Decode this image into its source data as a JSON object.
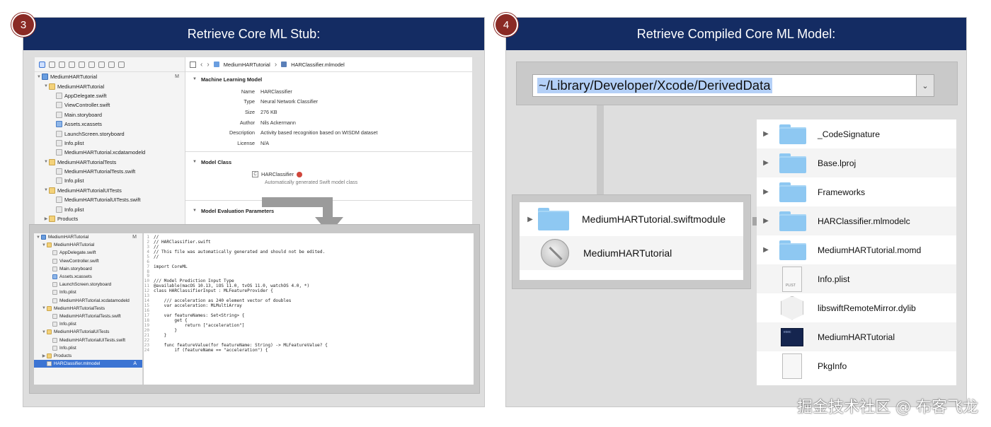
{
  "panel3": {
    "badge": "3",
    "title": "Retrieve Core ML Stub:",
    "navigator": [
      {
        "label": "MediumHARTutorial",
        "depth": 0,
        "icon": "project",
        "tri": "▼",
        "flag": "M"
      },
      {
        "label": "MediumHARTutorial",
        "depth": 1,
        "icon": "folder",
        "tri": "▼"
      },
      {
        "label": "AppDelegate.swift",
        "depth": 2,
        "icon": "file"
      },
      {
        "label": "ViewController.swift",
        "depth": 2,
        "icon": "file"
      },
      {
        "label": "Main.storyboard",
        "depth": 2,
        "icon": "file"
      },
      {
        "label": "Assets.xcassets",
        "depth": 2,
        "icon": "asset"
      },
      {
        "label": "LaunchScreen.storyboard",
        "depth": 2,
        "icon": "file"
      },
      {
        "label": "Info.plist",
        "depth": 2,
        "icon": "file"
      },
      {
        "label": "MediumHARTutorial.xcdatamodeld",
        "depth": 2,
        "icon": "file"
      },
      {
        "label": "MediumHARTutorialTests",
        "depth": 1,
        "icon": "folder",
        "tri": "▼"
      },
      {
        "label": "MediumHARTutorialTests.swift",
        "depth": 2,
        "icon": "file"
      },
      {
        "label": "Info.plist",
        "depth": 2,
        "icon": "file"
      },
      {
        "label": "MediumHARTutorialUITests",
        "depth": 1,
        "icon": "folder",
        "tri": "▼"
      },
      {
        "label": "MediumHARTutorialUITests.swift",
        "depth": 2,
        "icon": "file"
      },
      {
        "label": "Info.plist",
        "depth": 2,
        "icon": "file"
      },
      {
        "label": "Products",
        "depth": 1,
        "icon": "folder",
        "tri": "▶"
      }
    ],
    "breadcrumb": [
      "MediumHARTutorial",
      "HARClassifier.mlmodel"
    ],
    "ml_section_title": "Machine Learning Model",
    "ml_fields": [
      {
        "key": "Name",
        "value": "HARClassifier"
      },
      {
        "key": "Type",
        "value": "Neural Network Classifier"
      },
      {
        "key": "Size",
        "value": "276 KB"
      },
      {
        "key": "Author",
        "value": "Nils Ackermann"
      },
      {
        "key": "Description",
        "value": "Activity based recognition based on WISDM dataset"
      },
      {
        "key": "License",
        "value": "N/A"
      }
    ],
    "model_class_title": "Model Class",
    "model_class_name": "HARClassifier",
    "model_class_sub": "Automatically generated Swift model class",
    "eval_title": "Model Evaluation Parameters",
    "code_navigator": [
      {
        "label": "MediumHARTutorial",
        "depth": 0,
        "icon": "project",
        "tri": "▼",
        "flag": "M"
      },
      {
        "label": "MediumHARTutorial",
        "depth": 1,
        "icon": "folder",
        "tri": "▼"
      },
      {
        "label": "AppDelegate.swift",
        "depth": 2,
        "icon": "file"
      },
      {
        "label": "ViewController.swift",
        "depth": 2,
        "icon": "file"
      },
      {
        "label": "Main.storyboard",
        "depth": 2,
        "icon": "file"
      },
      {
        "label": "Assets.xcassets",
        "depth": 2,
        "icon": "asset"
      },
      {
        "label": "LaunchScreen.storyboard",
        "depth": 2,
        "icon": "file"
      },
      {
        "label": "Info.plist",
        "depth": 2,
        "icon": "file"
      },
      {
        "label": "MediumHARTutorial.xcdatamodeld",
        "depth": 2,
        "icon": "file"
      },
      {
        "label": "MediumHARTutorialTests",
        "depth": 1,
        "icon": "folder",
        "tri": "▼"
      },
      {
        "label": "MediumHARTutorialTests.swift",
        "depth": 2,
        "icon": "file"
      },
      {
        "label": "Info.plist",
        "depth": 2,
        "icon": "file"
      },
      {
        "label": "MediumHARTutorialUITests",
        "depth": 1,
        "icon": "folder",
        "tri": "▼"
      },
      {
        "label": "MediumHARTutorialUITests.swift",
        "depth": 2,
        "icon": "file"
      },
      {
        "label": "Info.plist",
        "depth": 2,
        "icon": "file"
      },
      {
        "label": "Products",
        "depth": 1,
        "icon": "folder",
        "tri": "▶"
      },
      {
        "label": "HARClassifier.mlmodel",
        "depth": 1,
        "icon": "file",
        "selected": true,
        "flag": "A"
      }
    ],
    "code_lines": [
      {
        "n": "1",
        "t": "//",
        "c": "cm"
      },
      {
        "n": "2",
        "t": "// HARClassifier.swift",
        "c": "cm"
      },
      {
        "n": "3",
        "t": "//",
        "c": "cm"
      },
      {
        "n": "4",
        "t": "// This file was automatically generated and should not be edited.",
        "c": "cm"
      },
      {
        "n": "5",
        "t": "//",
        "c": "cm"
      },
      {
        "n": "6",
        "t": "",
        "c": ""
      },
      {
        "n": "7",
        "t": "import CoreML",
        "c": "kw"
      },
      {
        "n": "8",
        "t": "",
        "c": ""
      },
      {
        "n": "9",
        "t": "",
        "c": ""
      },
      {
        "n": "10",
        "t": "/// Model Prediction Input Type",
        "c": "cm"
      },
      {
        "n": "11",
        "t": "@available(macOS 10.13, iOS 11.0, tvOS 11.0, watchOS 4.0, *)",
        "c": "kw"
      },
      {
        "n": "12",
        "t": "class HARClassifierInput : MLFeatureProvider {",
        "c": ""
      },
      {
        "n": "13",
        "t": "",
        "c": ""
      },
      {
        "n": "14",
        "t": "    /// acceleration as 240 element vector of doubles",
        "c": "cm"
      },
      {
        "n": "15",
        "t": "    var acceleration: MLMultiArray",
        "c": ""
      },
      {
        "n": "16",
        "t": "",
        "c": ""
      },
      {
        "n": "17",
        "t": "    var featureNames: Set<String> {",
        "c": ""
      },
      {
        "n": "18",
        "t": "        get {",
        "c": ""
      },
      {
        "n": "19",
        "t": "            return [\"acceleration\"]",
        "c": ""
      },
      {
        "n": "20",
        "t": "        }",
        "c": ""
      },
      {
        "n": "21",
        "t": "    }",
        "c": ""
      },
      {
        "n": "22",
        "t": "",
        "c": ""
      },
      {
        "n": "23",
        "t": "    func featureValue(for featureName: String) -> MLFeatureValue? {",
        "c": ""
      },
      {
        "n": "24",
        "t": "        if (featureName == \"acceleration\") {",
        "c": ""
      }
    ]
  },
  "panel4": {
    "badge": "4",
    "title": "Retrieve Compiled Core ML Model:",
    "path": "~/Library/Developer/Xcode/DerivedData",
    "left_items": [
      {
        "name": "MediumHARTutorial.swiftmodule",
        "icon": "folder",
        "tri": "▶"
      },
      {
        "name": "MediumHARTutorial",
        "icon": "app",
        "tri": ""
      }
    ],
    "right_items": [
      {
        "name": "_CodeSignature",
        "icon": "folder",
        "tri": "▶"
      },
      {
        "name": "Base.lproj",
        "icon": "folder",
        "tri": "▶"
      },
      {
        "name": "Frameworks",
        "icon": "folder",
        "tri": "▶"
      },
      {
        "name": "HARClassifier.mlmodelc",
        "icon": "folder",
        "tri": "▶"
      },
      {
        "name": "MediumHARTutorial.momd",
        "icon": "folder",
        "tri": "▶"
      },
      {
        "name": "Info.plist",
        "icon": "plist",
        "tri": ""
      },
      {
        "name": "libswiftRemoteMirror.dylib",
        "icon": "dylib",
        "tri": ""
      },
      {
        "name": "MediumHARTutorial",
        "icon": "exec",
        "tri": ""
      },
      {
        "name": "PkgInfo",
        "icon": "doc",
        "tri": ""
      }
    ]
  },
  "watermark": "掘金技术社区 @ 布客飞龙",
  "colors": {
    "header": "#142c63",
    "badge": "#8a2a25",
    "selection": "#b4d0f7"
  }
}
